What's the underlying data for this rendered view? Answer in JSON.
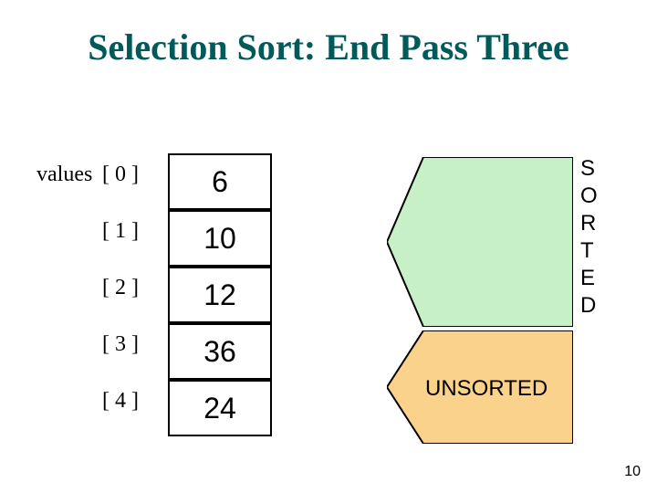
{
  "title": "Selection Sort: End Pass Three",
  "values_word": "values",
  "indices": [
    "[ 0 ]",
    "[ 1 ]",
    "[ 2 ]",
    "[ 3 ]",
    "[ 4 ]"
  ],
  "cells": [
    "6",
    "10",
    "12",
    "36",
    "24"
  ],
  "sorted_letters": [
    "S",
    "O",
    "R",
    "T",
    "E",
    "D"
  ],
  "unsorted_label": "UNSORTED",
  "page_number": "10",
  "colors": {
    "title": "#005a5a",
    "sorted_fill": "#c7f0c7",
    "unsorted_fill": "#fbd28b",
    "stroke": "#000000"
  }
}
